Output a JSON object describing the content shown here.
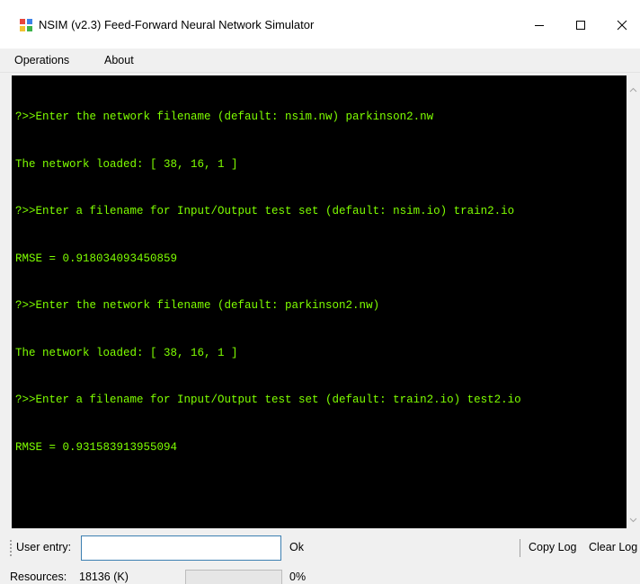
{
  "window": {
    "title": "NSIM (v2.3) Feed-Forward Neural Network Simulator"
  },
  "menu": {
    "items": [
      {
        "label": "Operations"
      },
      {
        "label": "About"
      }
    ]
  },
  "console": {
    "text_color": "#7fff00",
    "background": "#000000",
    "lines": [
      "?>>Enter the network filename (default: nsim.nw) parkinson2.nw",
      "The network loaded: [ 38, 16, 1 ]",
      "?>>Enter a filename for Input/Output test set (default: nsim.io) train2.io",
      "RMSE = 0.918034093450859",
      "?>>Enter the network filename (default: parkinson2.nw)",
      "The network loaded: [ 38, 16, 1 ]",
      "?>>Enter a filename for Input/Output test set (default: train2.io) test2.io",
      "RMSE = 0.931583913955094"
    ]
  },
  "toolbar": {
    "user_entry_label": "User entry:",
    "user_entry_value": "",
    "ok_label": "Ok",
    "copy_log_label": "Copy Log",
    "clear_log_label": "Clear Log"
  },
  "status": {
    "resources_label": "Resources:",
    "resources_value": "18136 (K)",
    "progress_fraction": 0.0,
    "progress_text": "0%",
    "progress_color": "#06b025"
  },
  "icons": {
    "app": "network-app-icon",
    "minimize": "minimize-icon",
    "maximize": "maximize-icon",
    "close": "close-icon",
    "scroll_up": "chevron-up-icon",
    "scroll_down": "chevron-down-icon"
  }
}
